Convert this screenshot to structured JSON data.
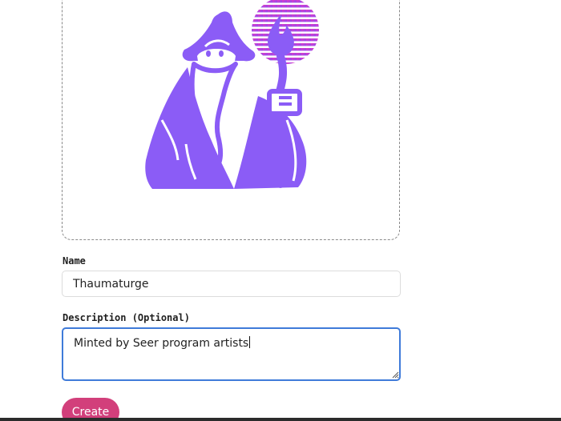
{
  "upload": {
    "image_icon": "wizard-with-staff-illustration"
  },
  "colors": {
    "art_purple": "#8b5cf6",
    "orb_magenta": "#d63bd0",
    "focus_blue": "#3f7bd9",
    "button_pink": "#d23f7b"
  },
  "form": {
    "name_label": "Name",
    "name_value": "Thaumaturge",
    "description_label": "Description (Optional)",
    "description_value": "Minted by Seer program artists",
    "create_label": "Create"
  }
}
